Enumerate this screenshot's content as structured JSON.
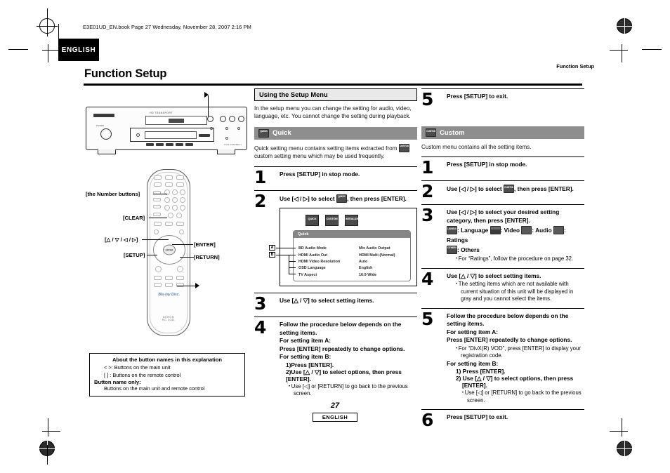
{
  "page": {
    "file_header": "E3E01UD_EN.book  Page 27  Wednesday, November 28, 2007  2:16 PM",
    "language_tab": "ENGLISH",
    "running_head": "Function Setup",
    "title": "Function Setup",
    "page_number": "27",
    "footer_language": "ENGLISH"
  },
  "left": {
    "callouts": {
      "number_buttons": "[the Number buttons]",
      "clear": "[CLEAR]",
      "cursor": "[△ / ▽ / ◁ / ▷]",
      "setup": "[SETUP]",
      "enter": "[ENTER]",
      "return": "[RETURN]"
    },
    "device": {
      "caption": "HD TRANSPORT",
      "knob_label": "POWER",
      "model": "DVD-3800BDCI"
    },
    "remote": {
      "enter_label": "ENTER",
      "bd_logo": "Blu-ray Disc",
      "brand": "DENON\nRC-1031"
    },
    "about_box": {
      "title": "About the button names in this explanation",
      "line1": "< >: Buttons on the main unit",
      "line2": "[  ]  : Buttons on the remote control",
      "line3_bold": "Button name only:",
      "line4": "Buttons on the main unit and remote control"
    }
  },
  "middle": {
    "section_heading": "Using the Setup Menu",
    "intro": "In the setup menu you can change the setting for audio, video, language, etc. You cannot change the setting during playback.",
    "quick_band": "Quick",
    "quick_icon": "QUICK",
    "quick_intro_a": "Quick setting menu contains setting items extracted from",
    "quick_intro_b": "custom setting menu which may be used frequently.",
    "quick_intro_icon": "CUSTOM",
    "steps": [
      {
        "num": "1",
        "text": "Press [SETUP] in stop mode."
      },
      {
        "num": "2",
        "text_a": "Use [◁ / ▷] to select",
        "icon": "QUICK",
        "text_b": ", then press [ENTER]."
      },
      {
        "num": "3",
        "text": "Use [△ / ▽] to select setting items."
      },
      {
        "num": "4",
        "line1": "Follow the procedure below depends on the setting items.",
        "line2": "For setting item A:",
        "line3": "Press [ENTER] repeatedly to change options.",
        "line4": "For setting item B:",
        "line5": "1)Press [ENTER].",
        "line6": "2)Use [△ / ▽] to select options, then press [ENTER].",
        "note": "Use [◁] or [RETURN] to go back to the previous screen."
      }
    ],
    "menu_shot": {
      "icons": [
        "QUICK",
        "CUSTOM",
        "INITIALIZE"
      ],
      "panel_title": "Quick",
      "marker_a": "A",
      "marker_b": "B",
      "rows": [
        {
          "key": "BD Audio Mode",
          "value": "Mix Audio Output"
        },
        {
          "key": "HDMI Audio Out",
          "value": "HDMI Multi (Normal)"
        },
        {
          "key": "HDMI Video Resolution",
          "value": "Auto"
        },
        {
          "key": "OSD Language",
          "value": "English"
        },
        {
          "key": "TV Aspect",
          "value": "16:9 Wide"
        }
      ]
    }
  },
  "right": {
    "quick_step5": {
      "num": "5",
      "text": "Press [SETUP] to exit."
    },
    "custom_band": "Custom",
    "custom_icon": "CUSTOM",
    "custom_intro": "Custom menu contains all the setting items.",
    "steps": [
      {
        "num": "1",
        "text": "Press [SETUP] in stop mode."
      },
      {
        "num": "2",
        "text_a": "Use [◁ / ▷] to select",
        "icon": "CUSTOM",
        "text_b": ", then press [ENTER]."
      },
      {
        "num": "3",
        "line1": "Use [◁ / ▷] to select your desired setting category, then press [ENTER].",
        "categories": [
          {
            "icon": "LANGUAGE",
            "label": ": Language"
          },
          {
            "icon": "VIDEO",
            "label": ": Video"
          },
          {
            "icon": "AUDIO",
            "label": ": Audio"
          },
          {
            "icon": "RATINGS",
            "label": ": Ratings"
          },
          {
            "icon": "OTHERS",
            "label": ": Others"
          }
        ],
        "note": "For “Ratings”, follow the procedure on page 32."
      },
      {
        "num": "4",
        "line1": "Use [△ / ▽] to select setting items.",
        "note": "The setting items which are not available with current situation of this unit will be displayed in gray and you cannot select the items."
      },
      {
        "num": "5",
        "line1": "Follow the procedure below depends on the setting items.",
        "line2": "For setting item A:",
        "line3": "Press [ENTER] repeatedly to change options.",
        "note1": "For “DivX(R) VOD”, press [ENTER] to display your registration code.",
        "line4": "For setting item B:",
        "line5": "1)  Press [ENTER].",
        "line6": "2)  Use [△ / ▽] to select options, then press [ENTER].",
        "note2": "Use [◁] or [RETURN] to go back to the previous screen."
      },
      {
        "num": "6",
        "text": "Press [SETUP] to exit."
      }
    ]
  }
}
